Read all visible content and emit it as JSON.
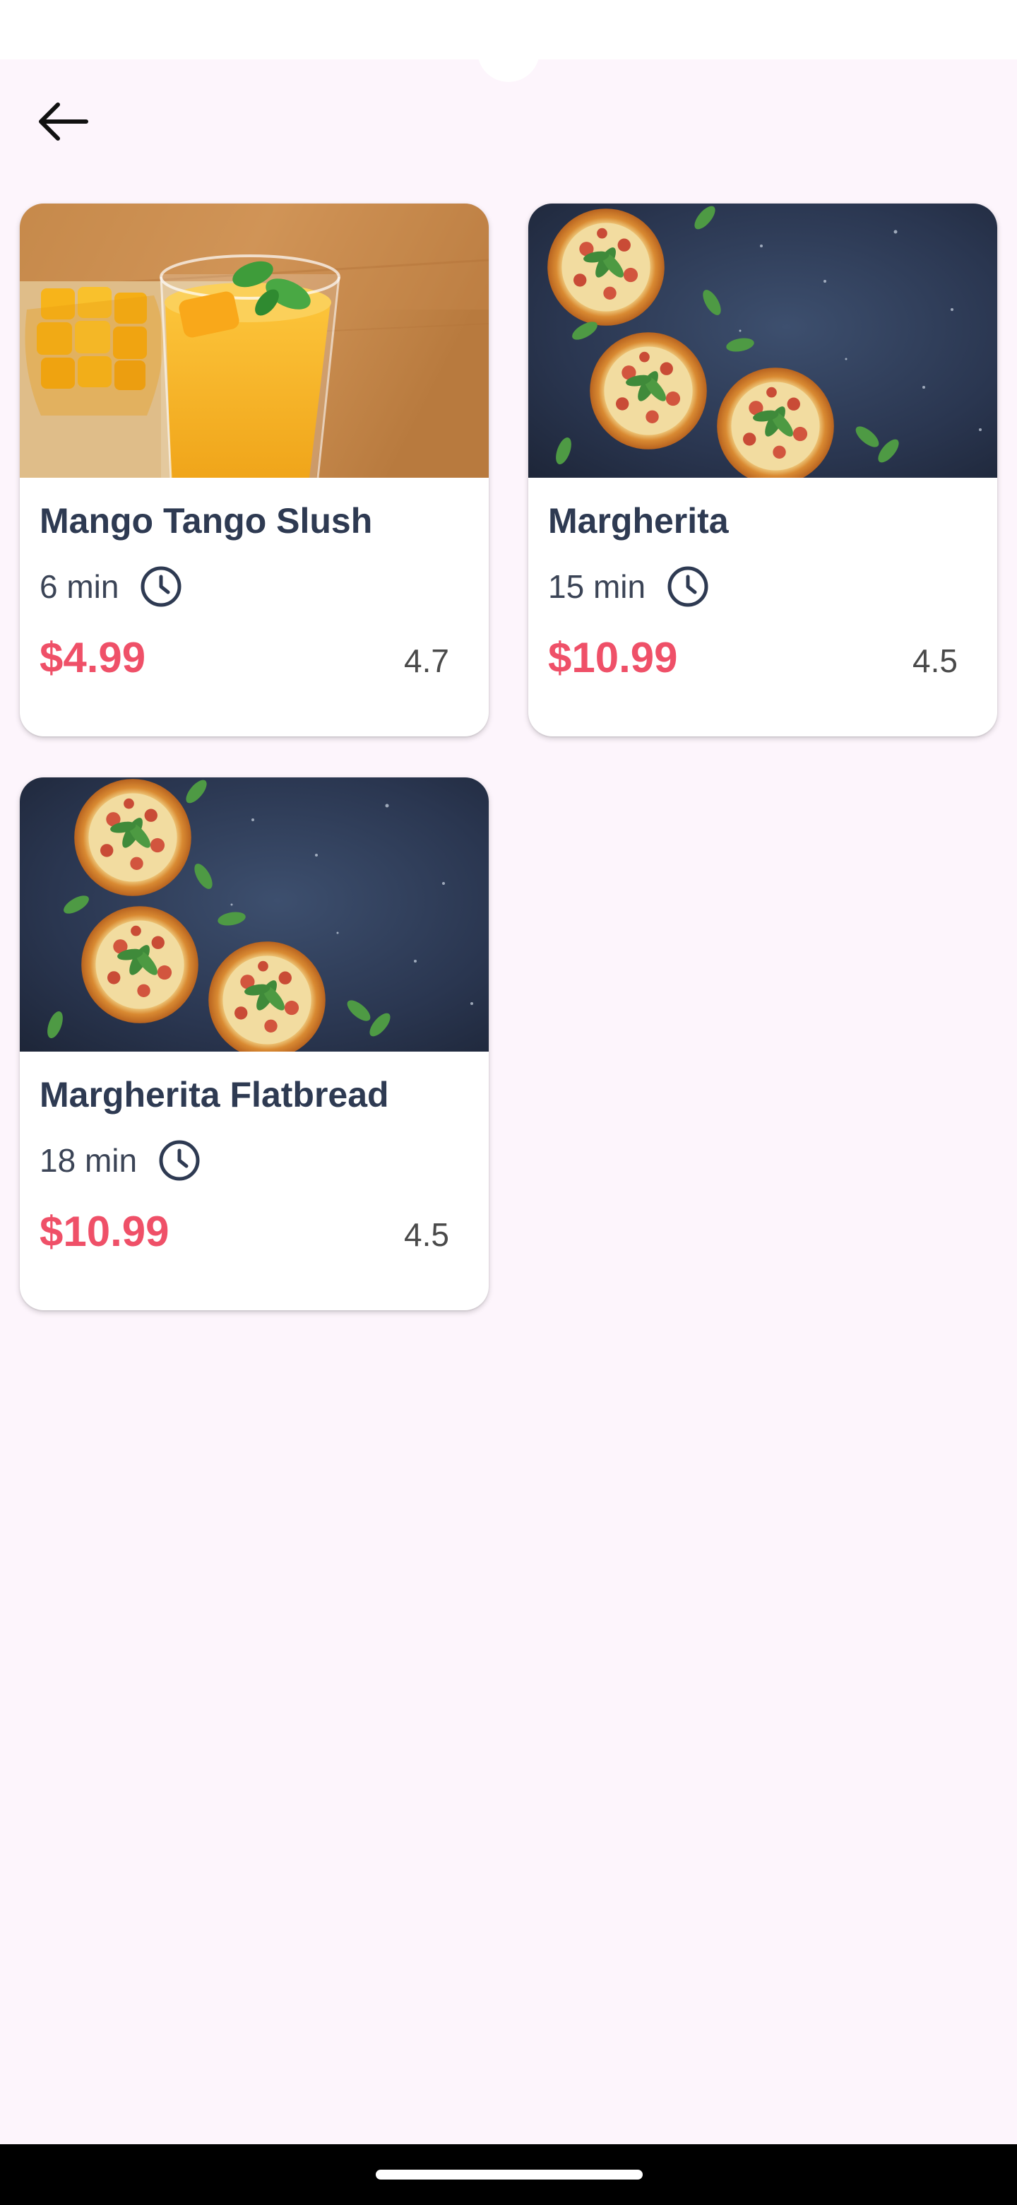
{
  "nav": {
    "back_icon": "arrow-left-icon"
  },
  "items": [
    {
      "title": "Mango Tango Slush",
      "time": "6 min",
      "price": "$4.99",
      "rating": "4.7",
      "image": "mango-smoothie-photo"
    },
    {
      "title": "Margherita",
      "time": "15 min",
      "price": "$10.99",
      "rating": "4.5",
      "image": "pizzas-on-dark-table-photo"
    },
    {
      "title": "Margherita Flatbread",
      "time": "18 min",
      "price": "$10.99",
      "rating": "4.5",
      "image": "pizzas-on-dark-table-photo"
    }
  ],
  "colors": {
    "background": "#fdf5fc",
    "title": "#2e3a52",
    "price": "#ef5068",
    "meta": "#3b4456"
  }
}
